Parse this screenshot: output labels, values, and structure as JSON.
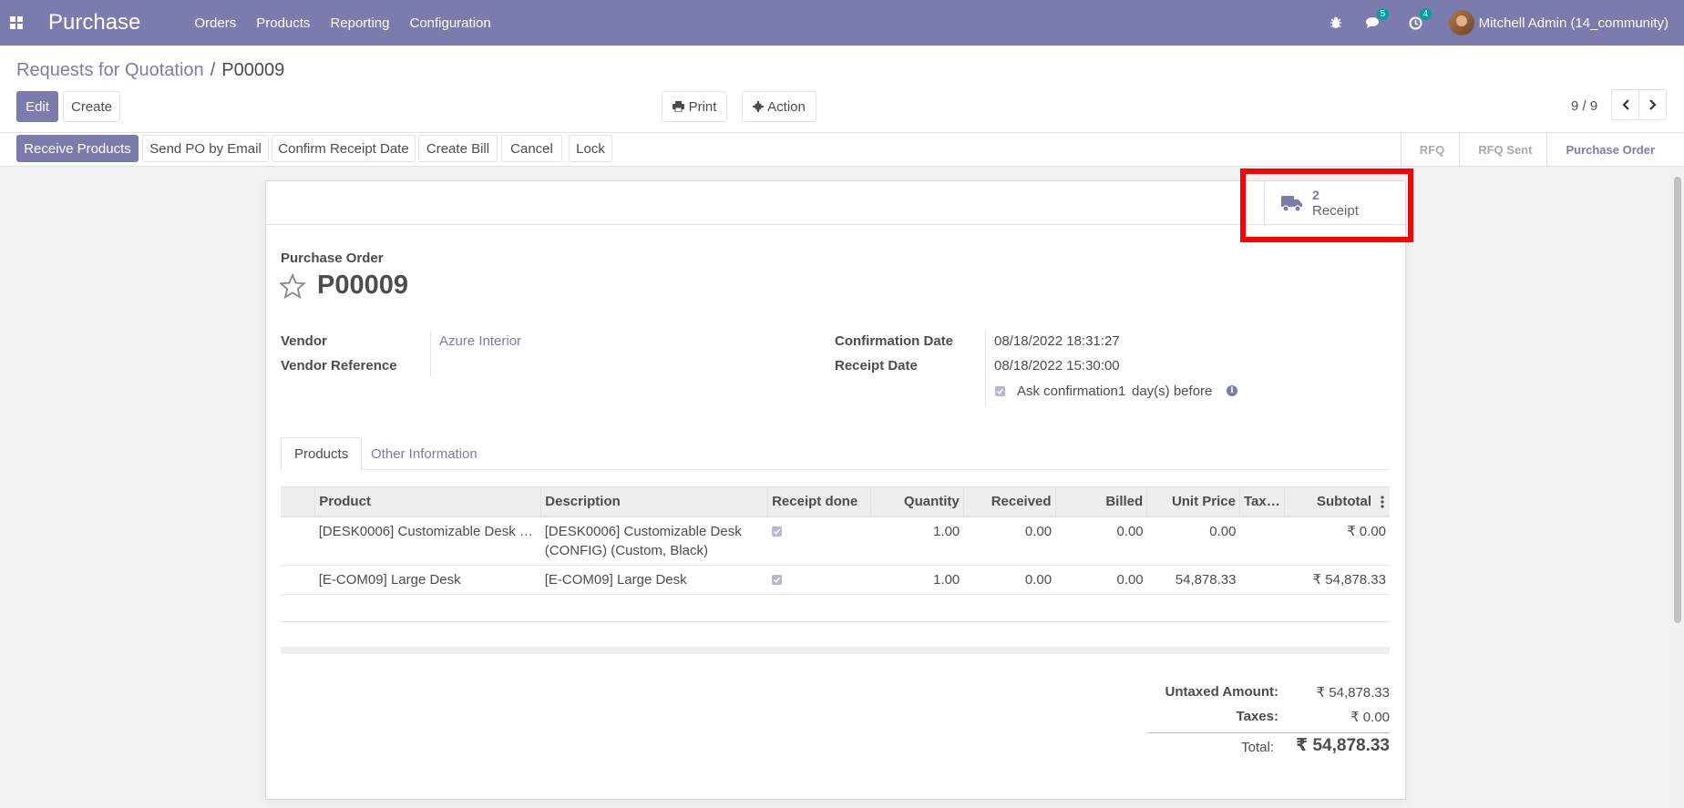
{
  "navbar": {
    "app_name": "Purchase",
    "menu": [
      "Orders",
      "Products",
      "Reporting",
      "Configuration"
    ],
    "messages_count": "5",
    "activities_count": "4",
    "user_name": "Mitchell Admin (14_community)"
  },
  "breadcrumb": {
    "parent": "Requests for Quotation",
    "separator": "/",
    "current": "P00009"
  },
  "control": {
    "edit_label": "Edit",
    "create_label": "Create",
    "print_label": "Print",
    "action_label": "Action",
    "pager": "9 / 9"
  },
  "statusbar": {
    "buttons": [
      "Receive Products",
      "Send PO by Email",
      "Confirm Receipt Date",
      "Create Bill",
      "Cancel",
      "Lock"
    ],
    "stages": [
      "RFQ",
      "RFQ Sent",
      "Purchase Order"
    ],
    "active_stage": "Purchase Order"
  },
  "smart_button": {
    "value": "2",
    "label": "Receipt"
  },
  "form": {
    "doc_type": "Purchase Order",
    "name": "P00009",
    "vendor_label": "Vendor",
    "vendor_value": "Azure Interior",
    "vendor_ref_label": "Vendor Reference",
    "vendor_ref_value": "",
    "confirmation_date_label": "Confirmation Date",
    "confirmation_date_value": "08/18/2022 18:31:27",
    "receipt_date_label": "Receipt Date",
    "receipt_date_value": "08/18/2022 15:30:00",
    "ask_confirmation_label": "Ask confirmation",
    "ask_confirmation_days": "1",
    "ask_confirmation_suffix": "day(s) before"
  },
  "tabs": [
    "Products",
    "Other Information"
  ],
  "lines": {
    "columns": [
      "Product",
      "Description",
      "Receipt done",
      "Quantity",
      "Received",
      "Billed",
      "Unit Price",
      "Tax…",
      "Subtotal"
    ],
    "rows": [
      {
        "product": "[DESK0006] Customizable Desk (C…",
        "description": "[DESK0006] Customizable Desk (CONFIG) (Custom, Black)",
        "receipt_done": true,
        "quantity": "1.00",
        "received": "0.00",
        "billed": "0.00",
        "unit_price": "0.00",
        "taxes": "",
        "subtotal": "₹ 0.00"
      },
      {
        "product": "[E-COM09] Large Desk",
        "description": "[E-COM09] Large Desk",
        "receipt_done": true,
        "quantity": "1.00",
        "received": "0.00",
        "billed": "0.00",
        "unit_price": "54,878.33",
        "taxes": "",
        "subtotal": "₹ 54,878.33"
      }
    ]
  },
  "totals": {
    "untaxed_label": "Untaxed Amount:",
    "untaxed_value": "₹ 54,878.33",
    "taxes_label": "Taxes:",
    "taxes_value": "₹ 0.00",
    "total_label": "Total:",
    "total_value": "₹ 54,878.33"
  },
  "colors": {
    "brand": "#7c7bad",
    "highlight": "#ff0000"
  }
}
